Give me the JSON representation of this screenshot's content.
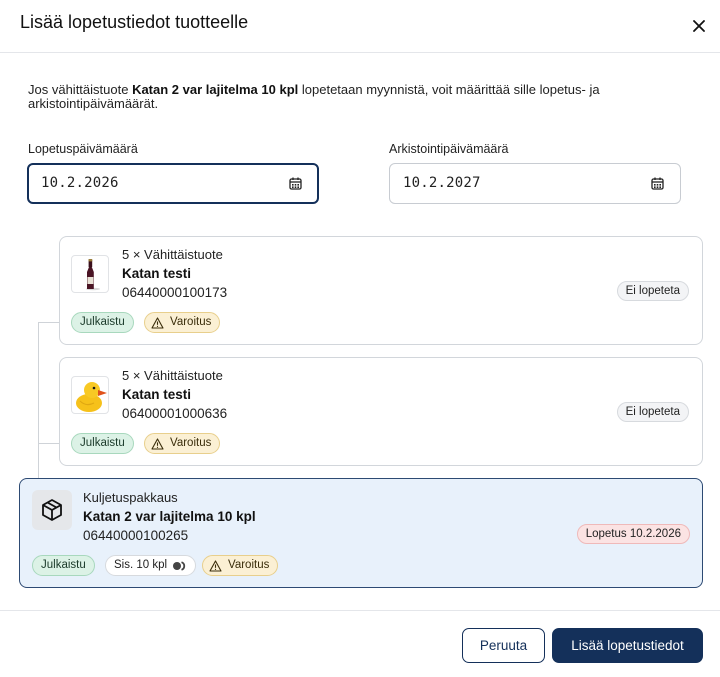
{
  "dialog": {
    "title": "Lisää lopetustiedot tuotteelle",
    "intro_prefix": "Jos vähittäistuote ",
    "intro_product": "Katan 2 var lajitelma 10 kpl",
    "intro_suffix": " lopetetaan myynnistä, voit määrittää sille lopetus- ja arkistointipäivämäärät."
  },
  "fields": {
    "end_date": {
      "label": "Lopetuspäivämäärä",
      "value": "10.2.2026"
    },
    "archive_date": {
      "label": "Arkistointipäivämäärä",
      "value": "10.2.2027"
    }
  },
  "items": [
    {
      "qty": "5 × Vähittäistuote",
      "name": "Katan testi",
      "code": "06440000100173",
      "image": "wine-bottle",
      "status": "Ei lopeteta",
      "badges": {
        "published": "Julkaistu",
        "warning": "Varoitus"
      }
    },
    {
      "qty": "5 × Vähittäistuote",
      "name": "Katan testi",
      "code": "06400001000636",
      "image": "rubber-duck",
      "status": "Ei lopeteta",
      "badges": {
        "published": "Julkaistu",
        "warning": "Varoitus"
      }
    }
  ],
  "package": {
    "type": "Kuljetuspakkaus",
    "name": "Katan 2 var lajitelma 10 kpl",
    "code": "06440000100265",
    "icon": "package-icon",
    "status": "Lopetus 10.2.2026",
    "badges": {
      "published": "Julkaistu",
      "contains": "Sis. 10 kpl",
      "warning": "Varoitus"
    }
  },
  "buttons": {
    "cancel": "Peruuta",
    "submit": "Lisää lopetustiedot"
  },
  "colors": {
    "primary": "#14305a",
    "selected_bg": "#e8f1fb",
    "published_bg": "#dcf2e6",
    "warning_bg": "#fbf0d4",
    "end_status_bg": "#fbe3e3"
  }
}
